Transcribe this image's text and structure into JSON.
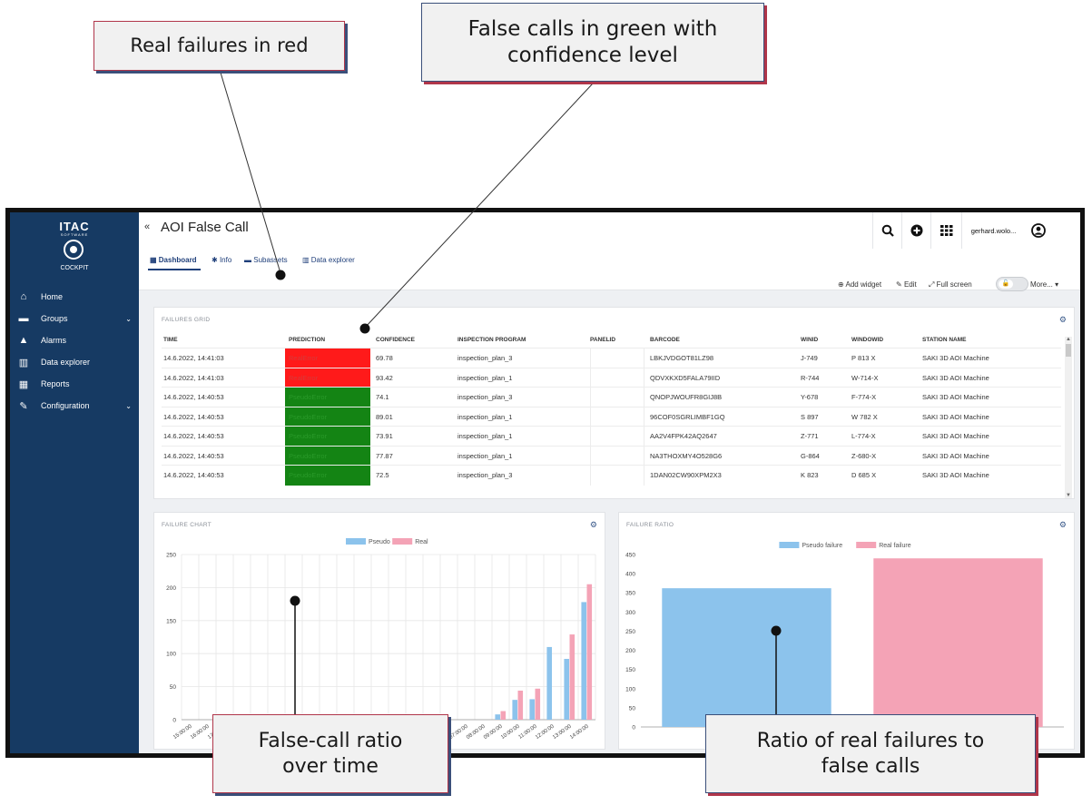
{
  "callouts": {
    "real_failures": "Real failures in red",
    "false_calls": "False calls in green with confidence level",
    "ratio_over_time": "False-call ratio over time",
    "ratio_real_false": "Ratio of real failures to false calls"
  },
  "sidebar": {
    "logo": "ITAC",
    "logo_sub": "SOFTWARE",
    "cockpit": "COCKPIT",
    "items": [
      {
        "label": "Home",
        "icon": "home-icon",
        "glyph": "⌂"
      },
      {
        "label": "Groups",
        "icon": "folder-icon",
        "glyph": "▬",
        "chevron": true
      },
      {
        "label": "Alarms",
        "icon": "bell-icon",
        "glyph": "▲"
      },
      {
        "label": "Data explorer",
        "icon": "chart-icon",
        "glyph": "▥"
      },
      {
        "label": "Reports",
        "icon": "grid-icon",
        "glyph": "▦"
      },
      {
        "label": "Configuration",
        "icon": "wrench-icon",
        "glyph": "✎",
        "chevron": true
      }
    ]
  },
  "header": {
    "back": "«",
    "title": "AOI False Call",
    "user": "gerhard.wolo...",
    "tabs": [
      "Dashboard",
      "Info",
      "Subassets",
      "Data explorer"
    ],
    "tools": {
      "add_widget": "Add widget",
      "edit": "Edit",
      "full_screen": "Full screen",
      "more": "More..."
    }
  },
  "failures_grid": {
    "title": "FAILURES GRID",
    "columns": [
      "TIME",
      "PREDICTION",
      "CONFIDENCE",
      "INSPECTION PROGRAM",
      "PANELID",
      "BARCODE",
      "WINID",
      "WINDOWID",
      "STATION NAME"
    ],
    "rows": [
      {
        "time": "14.6.2022, 14:41:03",
        "prediction": "RealError",
        "kind": "real",
        "confidence": "69.78",
        "program": "inspection_plan_3",
        "panelid": "",
        "barcode": "LBKJVDGOT81LZ98",
        "winid": "J-749",
        "windowid": "P 813 X",
        "station": "SAKI 3D AOI Machine"
      },
      {
        "time": "14.6.2022, 14:41:03",
        "prediction": "RealError",
        "kind": "real",
        "confidence": "93.42",
        "program": "inspection_plan_1",
        "panelid": "",
        "barcode": "QDVXKXD5FALA79IID",
        "winid": "R-744",
        "windowid": "W-714-X",
        "station": "SAKI 3D AOI Machine"
      },
      {
        "time": "14.6.2022, 14:40:53",
        "prediction": "PseudoError",
        "kind": "pseudo",
        "confidence": "74.1",
        "program": "inspection_plan_3",
        "panelid": "",
        "barcode": "QNOPJWOUFR8GIJ8B",
        "winid": "Y-678",
        "windowid": "F-774-X",
        "station": "SAKI 3D AOI Machine"
      },
      {
        "time": "14.6.2022, 14:40:53",
        "prediction": "PseudoError",
        "kind": "pseudo",
        "confidence": "89.01",
        "program": "inspection_plan_1",
        "panelid": "",
        "barcode": "96COF0SGRLIMBF1GQ",
        "winid": "S 897",
        "windowid": "W 782 X",
        "station": "SAKI 3D AOI Machine"
      },
      {
        "time": "14.6.2022, 14:40:53",
        "prediction": "PseudoError",
        "kind": "pseudo",
        "confidence": "73.91",
        "program": "inspection_plan_1",
        "panelid": "",
        "barcode": "AA2V4FPK42AQ2647",
        "winid": "Z-771",
        "windowid": "L-774-X",
        "station": "SAKI 3D AOI Machine"
      },
      {
        "time": "14.6.2022, 14:40:53",
        "prediction": "PseudoError",
        "kind": "pseudo",
        "confidence": "77.87",
        "program": "inspection_plan_1",
        "panelid": "",
        "barcode": "NA3THOXMY4O528G6",
        "winid": "G-864",
        "windowid": "Z-680-X",
        "station": "SAKI 3D AOI Machine"
      },
      {
        "time": "14.6.2022, 14:40:53",
        "prediction": "PseudoError",
        "kind": "pseudo",
        "confidence": "72.5",
        "program": "inspection_plan_3",
        "panelid": "",
        "barcode": "1DAN02CW90XPM2X3",
        "winid": "K 823",
        "windowid": "D 685 X",
        "station": "SAKI 3D AOI Machine"
      }
    ]
  },
  "chart_data": [
    {
      "type": "bar",
      "title": "FAILURE CHART",
      "categories": [
        "15:00:00",
        "16:00:00",
        "17:00:00",
        "18:00:00",
        "19:00:00",
        "20:00:00",
        "21:00:00",
        "22:00:00",
        "23:00:00",
        "00:00:00",
        "01:00:00",
        "02:00:00",
        "03:00:00",
        "04:00:00",
        "05:00:00",
        "06:00:00",
        "07:00:00",
        "08:00:00",
        "09:00:00",
        "10:00:00",
        "11:00:00",
        "12:00:00",
        "13:00:00",
        "14:00:00"
      ],
      "series": [
        {
          "name": "Pseudo",
          "color": "#8cc3ec",
          "values": [
            0,
            0,
            0,
            0,
            0,
            0,
            0,
            0,
            0,
            0,
            0,
            0,
            0,
            0,
            0,
            0,
            0,
            0,
            8,
            30,
            31,
            110,
            92,
            178
          ]
        },
        {
          "name": "Real",
          "color": "#f4a3b6",
          "values": [
            0,
            0,
            0,
            0,
            0,
            0,
            0,
            0,
            0,
            0,
            0,
            0,
            0,
            0,
            0,
            0,
            0,
            0,
            13,
            44,
            47,
            0,
            129,
            205
          ]
        }
      ],
      "ylim": [
        0,
        250
      ],
      "yticks": [
        0,
        50,
        100,
        150,
        200,
        250
      ],
      "legend": "top-center",
      "grid": true
    },
    {
      "type": "bar",
      "title": "FAILURE RATIO",
      "categories": [
        "Pseudo failure",
        "Real failure"
      ],
      "series": [
        {
          "name": "Pseudo failure",
          "color": "#8cc3ec",
          "values": [
            362
          ]
        },
        {
          "name": "Real failure",
          "color": "#f4a3b6",
          "values": [
            440
          ]
        }
      ],
      "ylim": [
        0,
        450
      ],
      "yticks": [
        0,
        50,
        100,
        150,
        200,
        250,
        300,
        350,
        400,
        450
      ],
      "legend": "top-center",
      "grid": false
    }
  ]
}
